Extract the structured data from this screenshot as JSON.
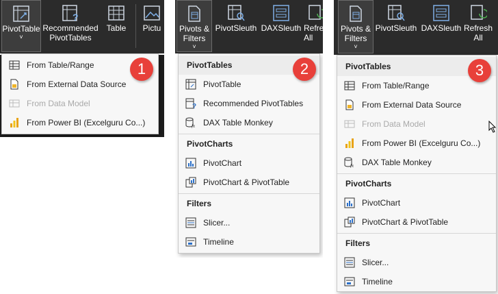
{
  "panel1": {
    "ribbon": {
      "buttons": [
        {
          "label": "PivotTable",
          "icon": "pivottable-icon"
        },
        {
          "label": "Recommended PivotTables",
          "icon": "recommended-pivottables-icon"
        },
        {
          "label": "Table",
          "icon": "table-icon"
        },
        {
          "label": "Pictu",
          "icon": "pictures-icon"
        }
      ],
      "chevron": "˅"
    },
    "menu": {
      "items": [
        {
          "label": "From Table/Range",
          "icon": "table-range-icon",
          "enabled": true
        },
        {
          "label": "From External Data Source",
          "icon": "external-data-icon",
          "enabled": true
        },
        {
          "label": "From Data Model",
          "icon": "data-model-icon",
          "enabled": false
        },
        {
          "label": "From Power BI (Excelguru Co...)",
          "icon": "power-bi-icon",
          "enabled": true
        }
      ]
    },
    "badge": "1"
  },
  "panel2": {
    "ribbon": {
      "buttons": [
        {
          "label": "Pivots & Filters",
          "icon": "pivots-filters-icon"
        },
        {
          "label": "PivotSleuth",
          "icon": "pivotsleuth-icon"
        },
        {
          "label": "DAXSleuth",
          "icon": "daxsleuth-icon"
        },
        {
          "label": "Refresh All",
          "icon": "refresh-icon"
        }
      ],
      "chevron": "˅"
    },
    "menu": {
      "sections": [
        {
          "header": "PivotTables",
          "items": [
            {
              "label": "PivotTable",
              "icon": "pivottable-icon"
            },
            {
              "label": "Recommended PivotTables",
              "icon": "recommended-pivottables-icon"
            },
            {
              "label": "DAX Table Monkey",
              "icon": "dax-table-monkey-icon"
            }
          ]
        },
        {
          "header": "PivotCharts",
          "items": [
            {
              "label": "PivotChart",
              "icon": "pivotchart-icon"
            },
            {
              "label": "PivotChart & PivotTable",
              "icon": "pivotchart-pivottable-icon"
            }
          ]
        },
        {
          "header": "Filters",
          "items": [
            {
              "label": "Slicer...",
              "icon": "slicer-icon"
            },
            {
              "label": "Timeline",
              "icon": "timeline-icon"
            }
          ]
        }
      ]
    },
    "badge": "2"
  },
  "panel3": {
    "ribbon": {
      "buttons": [
        {
          "label": "Pivots & Filters",
          "icon": "pivots-filters-icon"
        },
        {
          "label": "PivotSleuth",
          "icon": "pivotsleuth-icon"
        },
        {
          "label": "DAXSleuth",
          "icon": "daxsleuth-icon"
        },
        {
          "label": "Refresh All",
          "icon": "refresh-icon"
        }
      ],
      "chevron": "˅"
    },
    "menu": {
      "sections": [
        {
          "header": "PivotTables",
          "items": [
            {
              "label": "From Table/Range",
              "icon": "table-range-icon",
              "enabled": true
            },
            {
              "label": "From External Data Source",
              "icon": "external-data-icon",
              "enabled": true
            },
            {
              "label": "From Data Model",
              "icon": "data-model-icon",
              "enabled": false
            },
            {
              "label": "From Power BI (Excelguru Co...)",
              "icon": "power-bi-icon",
              "enabled": true
            },
            {
              "label": "DAX Table Monkey",
              "icon": "dax-table-monkey-icon",
              "enabled": true
            }
          ]
        },
        {
          "header": "PivotCharts",
          "items": [
            {
              "label": "PivotChart",
              "icon": "pivotchart-icon"
            },
            {
              "label": "PivotChart & PivotTable",
              "icon": "pivotchart-pivottable-icon"
            }
          ]
        },
        {
          "header": "Filters",
          "items": [
            {
              "label": "Slicer...",
              "icon": "slicer-icon"
            },
            {
              "label": "Timeline",
              "icon": "timeline-icon"
            }
          ]
        }
      ]
    },
    "badge": "3"
  },
  "colors": {
    "ribbon": "#2b2b2b",
    "menu_bg": "#f7f7f7",
    "header_bg": "#ececec",
    "badge": "#e8403a",
    "disabled_text": "#a9a9a9"
  }
}
